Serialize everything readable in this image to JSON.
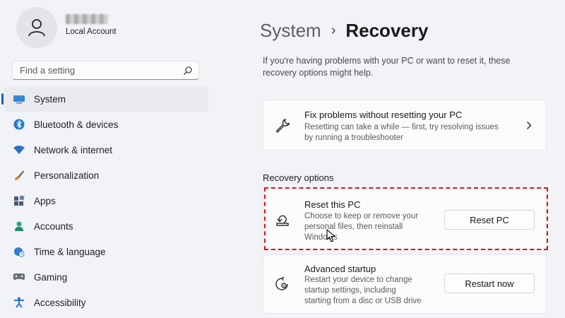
{
  "account": {
    "type_label": "Local Account"
  },
  "search": {
    "placeholder": "Find a setting"
  },
  "sidebar": {
    "items": [
      {
        "label": "System",
        "icon": "monitor-icon",
        "selected": true
      },
      {
        "label": "Bluetooth & devices",
        "icon": "bluetooth-icon"
      },
      {
        "label": "Network & internet",
        "icon": "wifi-icon"
      },
      {
        "label": "Personalization",
        "icon": "brush-icon"
      },
      {
        "label": "Apps",
        "icon": "apps-icon"
      },
      {
        "label": "Accounts",
        "icon": "person-icon"
      },
      {
        "label": "Time & language",
        "icon": "globe-clock-icon"
      },
      {
        "label": "Gaming",
        "icon": "gamepad-icon"
      },
      {
        "label": "Accessibility",
        "icon": "accessibility-icon"
      }
    ]
  },
  "breadcrumb": {
    "parent": "System",
    "separator": "›",
    "current": "Recovery"
  },
  "intro": "If you're having problems with your PC or want to reset it, these recovery options might help.",
  "fix_card": {
    "title": "Fix problems without resetting your PC",
    "desc_line1": "Resetting can take a while — first, try resolving issues",
    "desc_line2": "by running a troubleshooter",
    "icon": "wrench-icon"
  },
  "recovery": {
    "section_label": "Recovery options",
    "reset": {
      "title": "Reset this PC",
      "desc_line1": "Choose to keep or remove your",
      "desc_line2": "personal files, then reinstall",
      "desc_line3": "Windows",
      "button": "Reset PC",
      "icon": "reset-pc-icon"
    },
    "advanced": {
      "title": "Advanced startup",
      "desc_line1": "Restart your device to change",
      "desc_line2": "startup settings, including",
      "desc_line3": "starting from a disc or USB drive",
      "button": "Restart now",
      "icon": "advanced-startup-icon"
    }
  },
  "colors": {
    "accent": "#0067c0",
    "highlight": "#d9141a",
    "background": "#f2f3f7"
  }
}
